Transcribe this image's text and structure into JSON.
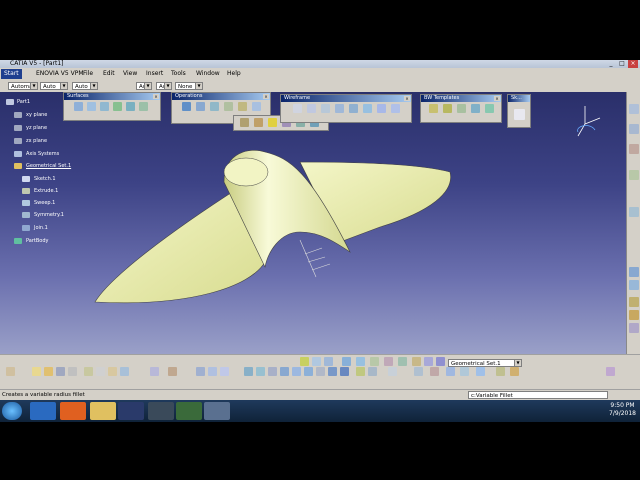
{
  "window": {
    "title": "CATIA V5 - [Part1]"
  },
  "menu": [
    "Start",
    "ENOVIA V5 VPM",
    "File",
    "Edit",
    "View",
    "Insert",
    "Tools",
    "Window",
    "Help"
  ],
  "combos": [
    "Automa",
    "Auto",
    "Auto",
    "Aut",
    "Aut",
    "None"
  ],
  "toolbars": {
    "surfaces": "Surfaces",
    "operations": "Operations",
    "wireframe": "Wireframe",
    "bw_templates": "BW Templates",
    "sk": "Sk..."
  },
  "tree": {
    "root": "Part1",
    "planes": [
      "xy plane",
      "yz plane",
      "zx plane"
    ],
    "axis_systems": "Axis Systems",
    "geometrical_set": "Geometrical Set.1",
    "features": [
      "Sketch.1",
      "Extrude.1",
      "Sweep.1",
      "Symmetry.1",
      "Join.1"
    ],
    "part_body": "PartBody"
  },
  "bottom": {
    "set_combo": "Geometrical Set.1"
  },
  "status": {
    "text": "Creates a variable radius fillet",
    "command": "c:Variable Fillet"
  },
  "clock": {
    "time": "9:50 PM",
    "date": "7/9/2018"
  },
  "colors": {
    "viewport_top": "#2a2f6a",
    "surface": "#eef0b0",
    "accent": "#0a246a"
  }
}
